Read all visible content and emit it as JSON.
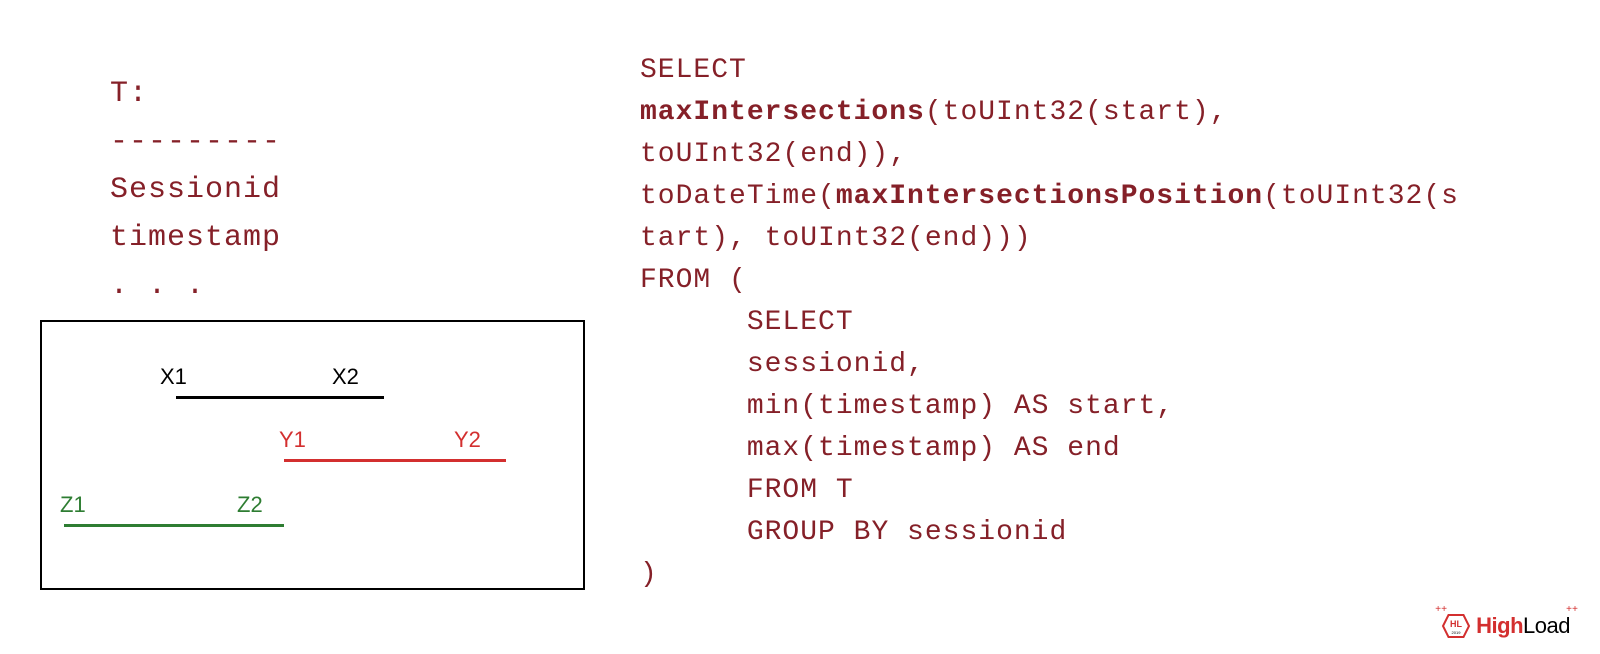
{
  "schema": {
    "title": "T:",
    "divider": "---------",
    "col1": "Sessionid",
    "col2": "timestamp",
    "col3": ". . ."
  },
  "intervals": {
    "x1": "X1",
    "x2": "X2",
    "y1": "Y1",
    "y2": "Y2",
    "z1": "Z1",
    "z2": "Z2"
  },
  "sql": {
    "line1": "SELECT",
    "line2_bold": "maxIntersections",
    "line2_rest": "(toUInt32(start),",
    "line3": "toUInt32(end)),",
    "line4_start": "toDateTime(",
    "line4_bold": "maxIntersectionsPosition",
    "line4_end": "(toUInt32(s",
    "line5": "tart), toUInt32(end)))",
    "line6": "FROM (",
    "line7": "      SELECT",
    "line8": "      sessionid,",
    "line9": "      min(timestamp) AS start,",
    "line10": "      max(timestamp) AS end",
    "line11": "      FROM T",
    "line12": "      GROUP BY sessionid",
    "line13": ")"
  },
  "logo": {
    "abbr": "HL",
    "year": "2019",
    "text_high": "High",
    "text_load": "Load"
  }
}
